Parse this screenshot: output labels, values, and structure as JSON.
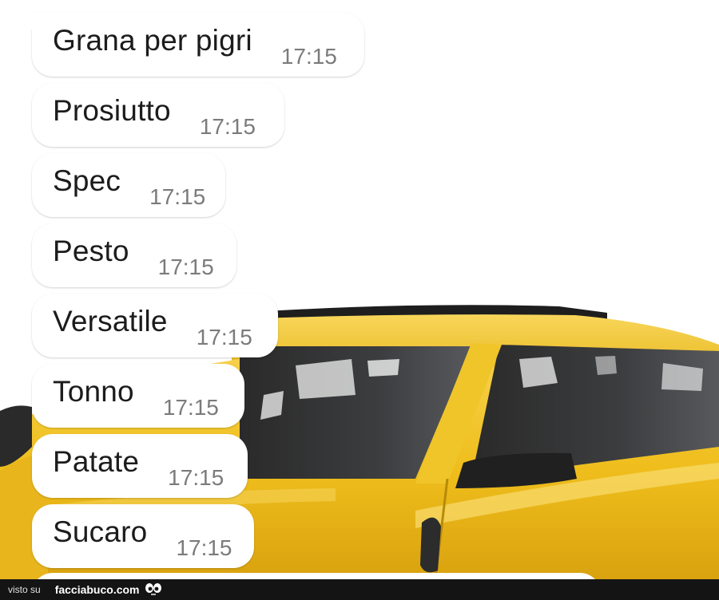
{
  "chat": {
    "messages": [
      {
        "text": "Grana per pigri",
        "time": "17:15"
      },
      {
        "text": "Prosiutto",
        "time": "17:15"
      },
      {
        "text": "Spec",
        "time": "17:15"
      },
      {
        "text": "Pesto",
        "time": "17:15"
      },
      {
        "text": "Versatile",
        "time": "17:15"
      },
      {
        "text": "Tonno",
        "time": "17:15"
      },
      {
        "text": "Patate",
        "time": "17:15"
      },
      {
        "text": "Sucaro",
        "time": "17:15"
      }
    ]
  },
  "footer": {
    "prefix": "visto su",
    "site": "facciabuco.com",
    "logo_icon": "eyes-icon"
  },
  "colors": {
    "bubble": "#ffffff",
    "message_text": "#1c1c1c",
    "timestamp": "#7b7b7b",
    "car_yellow": "#f2c21b",
    "footer_bg": "#141414"
  }
}
